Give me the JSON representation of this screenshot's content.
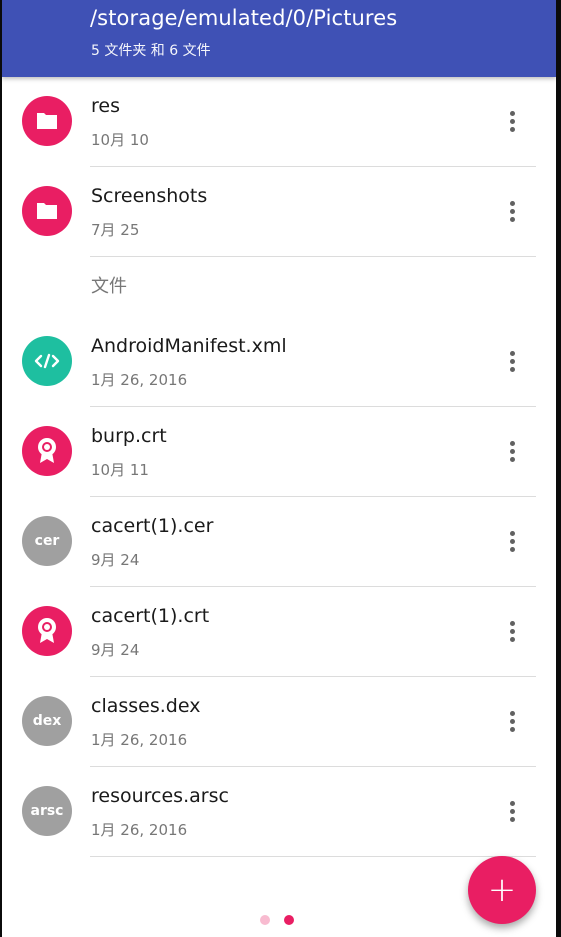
{
  "header": {
    "path": "/storage/emulated/0/Pictures",
    "summary": "5 文件夹 和 6 文件"
  },
  "folders": [
    {
      "name": "res",
      "date": "10月 10",
      "icon": "folder-icon",
      "color": "#e91e63"
    },
    {
      "name": "Screenshots",
      "date": "7月 25",
      "icon": "folder-icon",
      "color": "#e91e63"
    }
  ],
  "files_section_label": "文件",
  "files": [
    {
      "name": "AndroidManifest.xml",
      "date": "1月 26, 2016",
      "icon": "code-icon",
      "color": "#1ebfa0",
      "badge": ""
    },
    {
      "name": "burp.crt",
      "date": "10月 11",
      "icon": "certificate-icon",
      "color": "#e91e63",
      "badge": ""
    },
    {
      "name": "cacert(1).cer",
      "date": "9月 24",
      "icon": "text-badge-icon",
      "color": "#a0a0a0",
      "badge": "cer"
    },
    {
      "name": "cacert(1).crt",
      "date": "9月 24",
      "icon": "certificate-icon",
      "color": "#e91e63",
      "badge": ""
    },
    {
      "name": "classes.dex",
      "date": "1月 26, 2016",
      "icon": "text-badge-icon",
      "color": "#a0a0a0",
      "badge": "dex"
    },
    {
      "name": "resources.arsc",
      "date": "1月 26, 2016",
      "icon": "text-badge-icon",
      "color": "#a0a0a0",
      "badge": "arsc"
    }
  ],
  "fab": {
    "label": "+",
    "icon": "plus-icon",
    "color": "#e91e63"
  },
  "pager": {
    "page_count": 2,
    "active_page": 2,
    "active_color": "#e91e63",
    "inactive_color": "#f8bbd0"
  },
  "colors": {
    "appbar": "#3f51b5"
  }
}
